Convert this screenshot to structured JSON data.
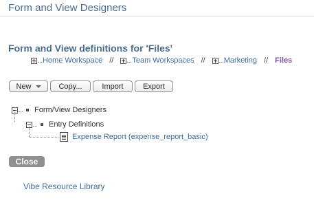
{
  "header": {
    "title": "Form and View Designers"
  },
  "section": {
    "title": "Form and View definitions for 'Files'"
  },
  "breadcrumb": {
    "items": [
      {
        "label": "Home Workspace"
      },
      {
        "label": "Team Workspaces"
      },
      {
        "label": "Marketing"
      }
    ],
    "separator": "//",
    "current": "Files"
  },
  "toolbar": {
    "new_label": "New",
    "copy_label": "Copy...",
    "import_label": "Import",
    "export_label": "Export"
  },
  "tree": {
    "root": "Form/View Designers",
    "child": "Entry Definitions",
    "leaf": "Expense Report (expense_report_basic)"
  },
  "close_label": "Close",
  "footer": {
    "resource_link": "Vibe Resource Library"
  }
}
